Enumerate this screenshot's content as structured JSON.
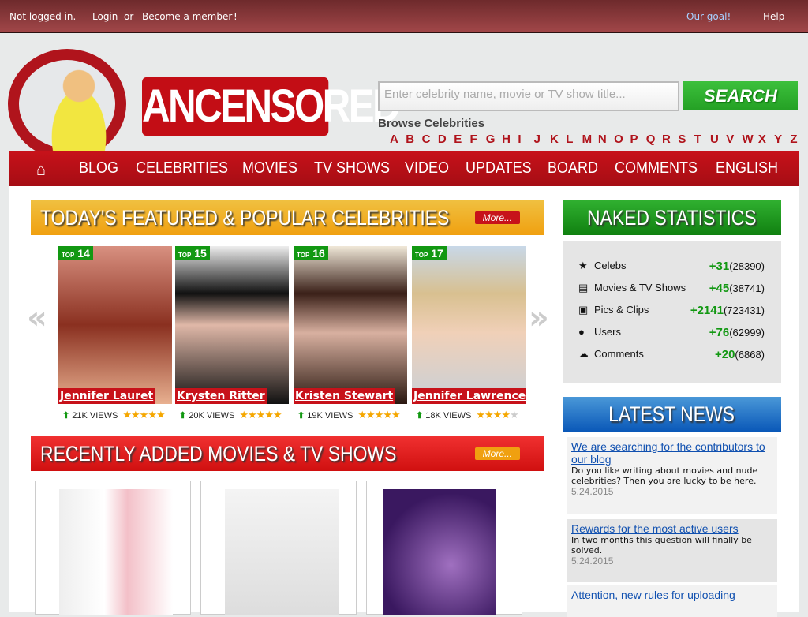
{
  "topbar": {
    "status": "Not logged in.",
    "login": "Login",
    "or": "or",
    "member": "Become a member",
    "excl": "!",
    "goal": "Our goal!",
    "help": "Help"
  },
  "logo": {
    "text": "ANCENSORED"
  },
  "search": {
    "placeholder": "Enter celebrity name, movie or TV show title...",
    "button": "SEARCH"
  },
  "browse": {
    "title": "Browse Celebrities",
    "letters": [
      "A",
      "B",
      "C",
      "D",
      "E",
      "F",
      "G",
      "H",
      "I",
      "J",
      "K",
      "L",
      "M",
      "N",
      "O",
      "P",
      "Q",
      "R",
      "S",
      "T",
      "U",
      "V",
      "W",
      "X",
      "Y",
      "Z"
    ]
  },
  "nav": {
    "home_icon": "home-icon",
    "items": [
      "BLOG",
      "CELEBRITIES",
      "MOVIES",
      "TV SHOWS",
      "VIDEO",
      "UPDATES",
      "BOARD",
      "COMMENTS",
      "ENGLISH"
    ]
  },
  "featured": {
    "title": "TODAY'S FEATURED & POPULAR CELEBRITIES",
    "more": "More...",
    "top_label": "TOP",
    "celebs": [
      {
        "rank": "14",
        "name": "Jennifer Lauret",
        "views": "21K VIEWS",
        "rating": 5
      },
      {
        "rank": "15",
        "name": "Krysten Ritter",
        "views": "20K VIEWS",
        "rating": 5
      },
      {
        "rank": "16",
        "name": "Kristen Stewart",
        "views": "19K VIEWS",
        "rating": 5
      },
      {
        "rank": "17",
        "name": "Jennifer Lawrence",
        "views": "18K VIEWS",
        "rating": 4
      }
    ]
  },
  "recent": {
    "title": "RECENTLY ADDED MOVIES & TV SHOWS",
    "more": "More..."
  },
  "stats": {
    "title": "NAKED STATISTICS",
    "rows": [
      {
        "icon": "star-icon",
        "label": "Celebs",
        "delta": "+31",
        "total": "(28390)"
      },
      {
        "icon": "film-icon",
        "label": "Movies & TV Shows",
        "delta": "+45",
        "total": "(38741)"
      },
      {
        "icon": "picture-icon",
        "label": "Pics & Clips",
        "delta": "+2141",
        "total": "(723431)"
      },
      {
        "icon": "user-icon",
        "label": "Users",
        "delta": "+76",
        "total": "(62999)"
      },
      {
        "icon": "comments-icon",
        "label": "Comments",
        "delta": "+20",
        "total": "(6868)"
      }
    ]
  },
  "news": {
    "title": "LATEST NEWS",
    "items": [
      {
        "title": "We are searching for the contributors to our blog",
        "text": "Do you like writing about movies and nude celebrities? Then you are lucky to be here.",
        "date": "5.24.2015"
      },
      {
        "title": "Rewards for the most active users",
        "text": "In two months this question will finally be solved.",
        "date": "5.24.2015"
      },
      {
        "title": "Attention, new rules for uploading"
      }
    ]
  }
}
